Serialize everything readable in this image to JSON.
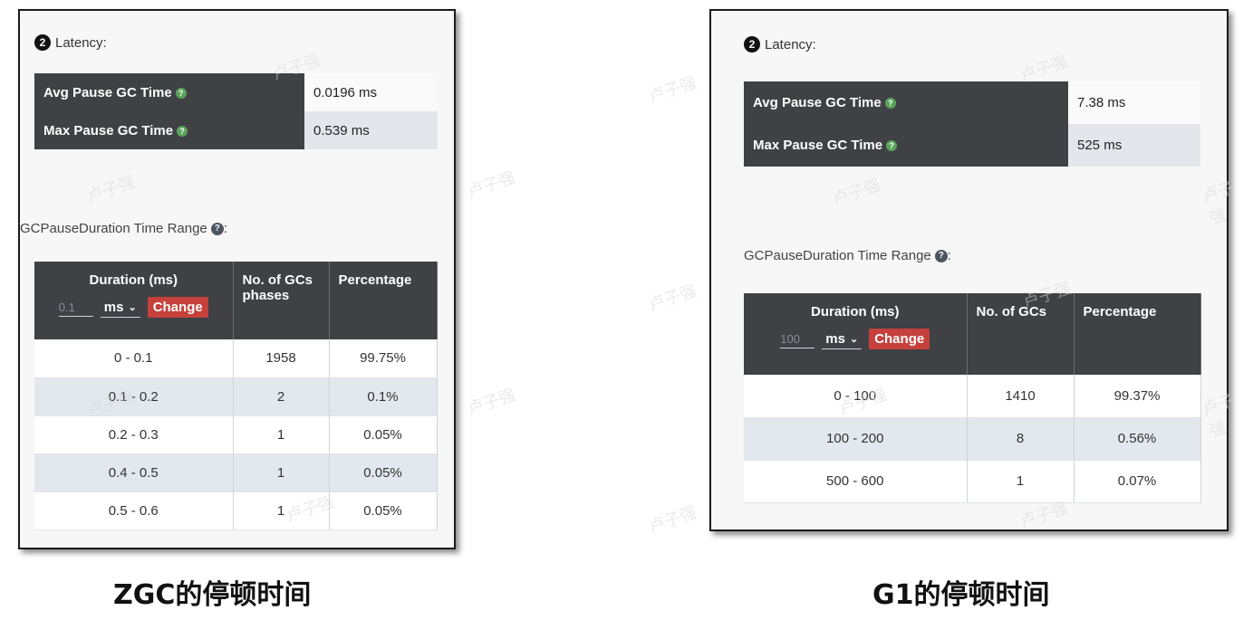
{
  "watermark": "卢子强",
  "zgc": {
    "badge": "2",
    "latency_title": "Latency:",
    "avg_label": "Avg Pause GC Time",
    "avg_value": "0.0196 ms",
    "max_label": "Max Pause GC Time",
    "max_value": "0.539 ms",
    "range_title": "GCPauseDuration Time Range",
    "range_suffix": ":",
    "headers": {
      "duration": "Duration (ms)",
      "count": "No. of GCs phases",
      "percentage": "Percentage"
    },
    "unit_input_value": "0.1",
    "unit_select": "ms",
    "change_label": "Change",
    "rows": [
      {
        "range": "0 - 0.1",
        "count": "1958",
        "pct": "99.75%"
      },
      {
        "range": "0.1 - 0.2",
        "count": "2",
        "pct": "0.1%"
      },
      {
        "range": "0.2 - 0.3",
        "count": "1",
        "pct": "0.05%"
      },
      {
        "range": "0.4 - 0.5",
        "count": "1",
        "pct": "0.05%"
      },
      {
        "range": "0.5 - 0.6",
        "count": "1",
        "pct": "0.05%"
      }
    ],
    "caption": "ZGC的停顿时间"
  },
  "g1": {
    "badge": "2",
    "latency_title": "Latency:",
    "avg_label": "Avg Pause GC Time",
    "avg_value": "7.38 ms",
    "max_label": "Max Pause GC Time",
    "max_value": "525 ms",
    "range_title": "GCPauseDuration Time Range",
    "range_suffix": ":",
    "headers": {
      "duration": "Duration (ms)",
      "count": "No. of GCs",
      "percentage": "Percentage"
    },
    "unit_input_value": "100",
    "unit_select": "ms",
    "change_label": "Change",
    "rows": [
      {
        "range": "0 - 100",
        "count": "1410",
        "pct": "99.37%"
      },
      {
        "range": "100 - 200",
        "count": "8",
        "pct": "0.56%"
      },
      {
        "range": "500 - 600",
        "count": "1",
        "pct": "0.07%"
      }
    ],
    "caption": "G1的停顿时间"
  }
}
